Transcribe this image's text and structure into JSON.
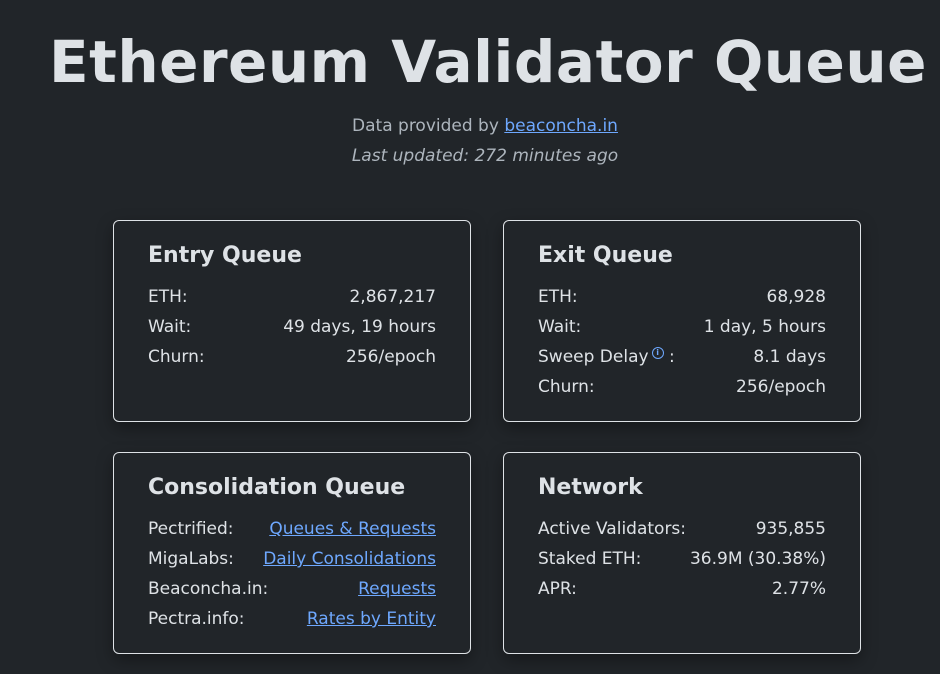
{
  "header": {
    "title": "Ethereum Validator Queue",
    "provided_prefix": "Data provided by ",
    "provider_link": "beaconcha.in",
    "last_updated": "Last updated: 272 minutes ago"
  },
  "entry": {
    "title": "Entry Queue",
    "rows": [
      {
        "label": "ETH:",
        "value": "2,867,217"
      },
      {
        "label": "Wait:",
        "value": "49 days, 19 hours"
      },
      {
        "label": "Churn:",
        "value": "256/epoch"
      }
    ]
  },
  "exit": {
    "title": "Exit Queue",
    "rows": [
      {
        "label": "ETH:",
        "value": "68,928"
      },
      {
        "label": "Wait:",
        "value": "1 day, 5 hours"
      },
      {
        "label": "Sweep Delay",
        "suffix": ":",
        "value": "8.1 days"
      },
      {
        "label": "Churn:",
        "value": "256/epoch"
      }
    ],
    "info_icon": "info-circle-icon"
  },
  "consolidation": {
    "title": "Consolidation Queue",
    "rows": [
      {
        "label": "Pectrified:",
        "link": "Queues & Requests"
      },
      {
        "label": "MigaLabs:",
        "link": "Daily Consolidations"
      },
      {
        "label": "Beaconcha.in:",
        "link": "Requests"
      },
      {
        "label": "Pectra.info:",
        "link": "Rates by Entity"
      }
    ]
  },
  "network": {
    "title": "Network",
    "rows": [
      {
        "label": "Active Validators:",
        "value": "935,855"
      },
      {
        "label": "Staked ETH:",
        "value": "36.9M (30.38%)"
      },
      {
        "label": "APR:",
        "value": "2.77%"
      }
    ]
  },
  "colors": {
    "background": "#212529",
    "text": "#dee2e6",
    "muted": "#adb5bd",
    "link": "#6ea8fe",
    "border": "#dee2e6"
  }
}
